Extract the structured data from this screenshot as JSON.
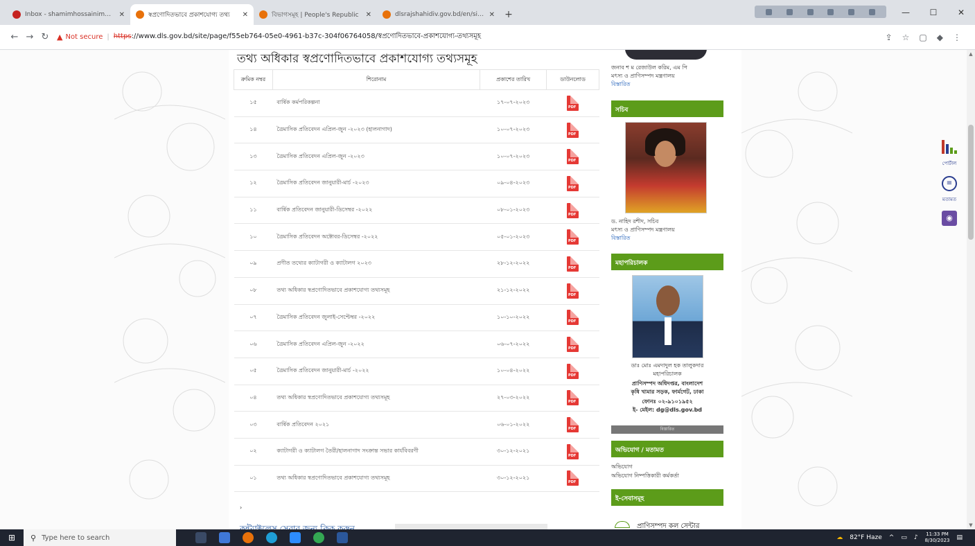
{
  "browser": {
    "tabs": [
      {
        "label": "Inbox - shamimhossainima@gm",
        "active": false,
        "color": "#c5221f"
      },
      {
        "label": "স্বপ্রণোদিতভাবে প্রকাশযোগ্য তথ্য",
        "active": true,
        "color": "#e8710a"
      },
      {
        "label": "বিভাগসমূহ | People's Republic",
        "active": false,
        "color": "#e8710a"
      },
      {
        "label": "dlsrajshahidiv.gov.bd/en/site/p",
        "active": false,
        "color": "#e8710a"
      }
    ],
    "not_secure": "Not secure",
    "url_https": "https",
    "url_rest": "://www.dls.gov.bd/site/page/f55eb764-05e0-4961-b37c-304f06764058/স্বপ্রণোদিতভাবে-প্রকাশযোগ্য-তথ্যসমূহ"
  },
  "page": {
    "title": "তথ্য অধিকার স্বপ্রণোদিতভাবে প্রকাশযোগ্য তথ্যসমূহ",
    "table": {
      "headers": [
        "ক্রমিক নম্বর",
        "শিরোনাম",
        "প্রকাশের তারিখ",
        "ডাউনলোড"
      ],
      "rows": [
        {
          "sl": "১৫",
          "title": "বার্ষিক কর্মপরিকল্পনা",
          "date": "১৭-০৭-২০২৩"
        },
        {
          "sl": "১৪",
          "title": "ত্রৈমাসিক প্রতিবেদন এপ্রিল-জুন -২০২৩ (হালনাগাদ)",
          "date": "১০-০৭-২০২৩"
        },
        {
          "sl": "১৩",
          "title": "ত্রৈমাসিক প্রতিবেদন এপ্রিল-জুন -২০২৩",
          "date": "১০-০৭-২০২৩"
        },
        {
          "sl": "১২",
          "title": "ত্রৈমাসিক প্রতিবেদন জানুয়ারী-মার্চ -২০২৩",
          "date": "০৯-০৪-২০২৩"
        },
        {
          "sl": "১১",
          "title": "বার্ষিক প্রতিবেদন জানুয়ারী-ডিসেম্বর -২০২২",
          "date": "০৮-০১-২০২৩"
        },
        {
          "sl": "১০",
          "title": "ত্রৈমাসিক প্রতিবেদন অক্টোবর-ডিসেম্বর -২০২২",
          "date": "০৫-০১-২০২৩"
        },
        {
          "sl": "০৯",
          "title": "প্রণীত তথ্যের ক্যাটাগরী ও ক্যাটালগ ২০২৩",
          "date": "২৮-১২-২০২২"
        },
        {
          "sl": "০৮",
          "title": "তথ্য অধিকার স্বপ্রণোদিতভাবে প্রকাশযোগ্য তথ্যসমূহ",
          "date": "২১-১২-২০২২"
        },
        {
          "sl": "০৭",
          "title": "ত্রৈমাসিক প্রতিবেদন জুলাই-সেপ্টেম্বর -২০২২",
          "date": "১০-১০-২০২২"
        },
        {
          "sl": "০৬",
          "title": "ত্রৈমাসিক প্রতিবেদন এপ্রিল-জুন -২০২২",
          "date": "০৬-০৭-২০২২"
        },
        {
          "sl": "০৫",
          "title": "ত্রৈমাসিক প্রতিবেদন জানুয়ারী-মার্চ -২০২২",
          "date": "১০-০৪-২০২২"
        },
        {
          "sl": "০৪",
          "title": "তথ্য অধিকার স্বপ্রণোদিতভাবে প্রকাশযোগ্য তথ্যসমূহ",
          "date": "২৭-০৩-২০২২"
        },
        {
          "sl": "০৩",
          "title": "বার্ষিক প্রতিবেদন ২০২১",
          "date": "০৬-০১-২০২২"
        },
        {
          "sl": "০২",
          "title": "ক্যাটাগরী ও ক্যাটালগ তৈরী/হালনাগাদ সংক্রান্ত সভার কার্যবিবরণী",
          "date": "৩০-১২-২০২১"
        },
        {
          "sl": "০১",
          "title": "তথ্য অধিকার স্বপ্রণোদিতভাবে প্রকাশযোগ্য তথ্যসমূহ",
          "date": "৩০-১২-২০২১"
        }
      ],
      "pdf_label": "PDF"
    },
    "caret": "›",
    "bottom_link": "কন্ট্যাক্টলেস সেবার জন্য ক্লিক করুন"
  },
  "sidebar": {
    "minister_name": "জনাব শ ম রেজাউল করিম, এম পি",
    "minister_ministry": "মৎস্য ও প্রাণিসম্পদ মন্ত্রণালয়",
    "details_link": "বিস্তারিত",
    "secretary_heading": "সচিব",
    "secretary_name": "ড. নাহিদ রশীদ, সচিব",
    "secretary_ministry": "মৎস্য ও প্রাণিসম্পদ মন্ত্রণালয়",
    "dg_heading": "মহাপরিচালক",
    "dg_name": "ডাঃ মোঃ এমদাদুল হক তালুকদার",
    "dg_title": "মহাপরিচালক",
    "dg_office": "প্রাণিসম্পদ অধিদপ্তর, বাংলাদেশ",
    "dg_address": "কৃষি খামার সড়ক, ফার্মগেট, ঢাকা",
    "dg_phone": "ফোনঃ ০২-৯১০১৯৫২",
    "dg_email": "ই- মেইল: dg@dls.gov.bd",
    "dg_more": "বিস্তারিত",
    "complaint_heading": "অভিযোগ / মতামত",
    "complaint_link": "অভিযোগ",
    "complaint_officer": "অভিযোগ নিষ্পত্তিকারী কর্মকর্তা",
    "eservice_heading": "ই-সেবাসমূহ",
    "callcenter": "প্রাণিসম্পদ কল সেন্টার"
  },
  "widget": {
    "portal_label": "পোর্টাল",
    "feedback_label": "মতামত"
  },
  "taskbar": {
    "search_placeholder": "Type here to search",
    "weather": "82°F Haze",
    "time": "11:33 PM",
    "date": "8/30/2023"
  }
}
